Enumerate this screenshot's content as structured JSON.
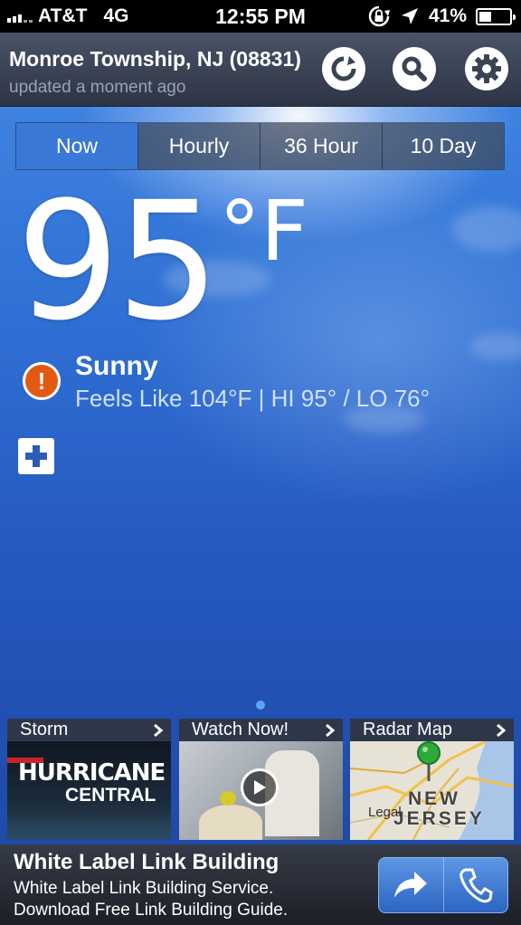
{
  "status_bar": {
    "carrier": "AT&T",
    "network": "4G",
    "time": "12:55 PM",
    "battery_percent": "41%",
    "battery_level": 0.41,
    "icons": [
      "signal-icon",
      "rotation-lock-icon",
      "location-arrow-icon",
      "battery-icon"
    ]
  },
  "header": {
    "location": "Monroe Township, NJ (08831)",
    "updated": "updated a moment ago",
    "buttons": [
      "refresh-icon",
      "search-icon",
      "settings-icon"
    ]
  },
  "tabs": [
    {
      "label": "Now",
      "active": true
    },
    {
      "label": "Hourly",
      "active": false
    },
    {
      "label": "36 Hour",
      "active": false
    },
    {
      "label": "10 Day",
      "active": false
    }
  ],
  "current": {
    "temperature": "95",
    "unit": "°F",
    "condition": "Sunny",
    "feels_like": "Feels Like 104°F | HI 95° / LO 76°",
    "alert_symbol": "!"
  },
  "tiles": [
    {
      "label": "Storm",
      "image_text_1": "HURRICANE",
      "image_text_2": "CENTRAL"
    },
    {
      "label": "Watch Now!"
    },
    {
      "label": "Radar Map",
      "map_label_1": "NEW",
      "map_label_2": "JERSEY",
      "map_legal": "Legal"
    }
  ],
  "ad": {
    "title": "White Label Link Building",
    "line1": "White Label Link Building Service.",
    "line2": "Download Free Link Building Guide."
  },
  "colors": {
    "active_tab": "#3a78d8",
    "alert": "#e25a12",
    "sky": "#2f6fd3"
  }
}
